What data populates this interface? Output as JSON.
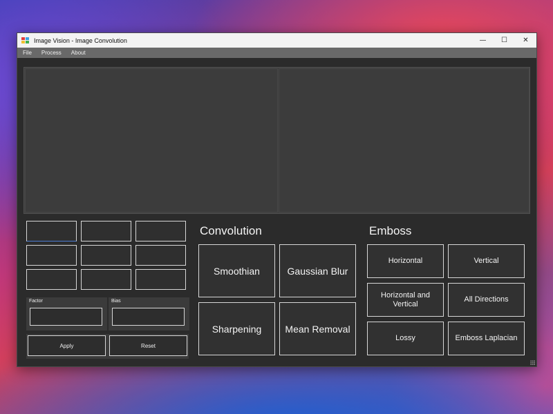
{
  "window": {
    "title": "Image Vision - Image Convolution",
    "controls": {
      "minimize": "—",
      "maximize": "☐",
      "close": "✕"
    }
  },
  "menu": [
    "File",
    "Process",
    "About"
  ],
  "kernel_matrix": {
    "cells": [
      "",
      "",
      "",
      "",
      "",
      "",
      "",
      "",
      ""
    ]
  },
  "factor": {
    "label": "Factor",
    "value": ""
  },
  "bias": {
    "label": "Bias",
    "value": ""
  },
  "actions": {
    "apply": "Apply",
    "reset": "Reset"
  },
  "convolution": {
    "heading": "Convolution",
    "buttons": [
      "Smoothian",
      "Gaussian Blur",
      "Sharpening",
      "Mean Removal"
    ]
  },
  "emboss": {
    "heading": "Emboss",
    "buttons": [
      "Horizontal",
      "Vertical",
      "Horizontal and Vertical",
      "All Directions",
      "Lossy",
      "Emboss Laplacian"
    ]
  },
  "colors": {
    "window_bg": "#2b2b2b",
    "menubar_bg": "#696969",
    "button_border": "#d8d8d8",
    "focus_accent": "#4d7fd6"
  }
}
